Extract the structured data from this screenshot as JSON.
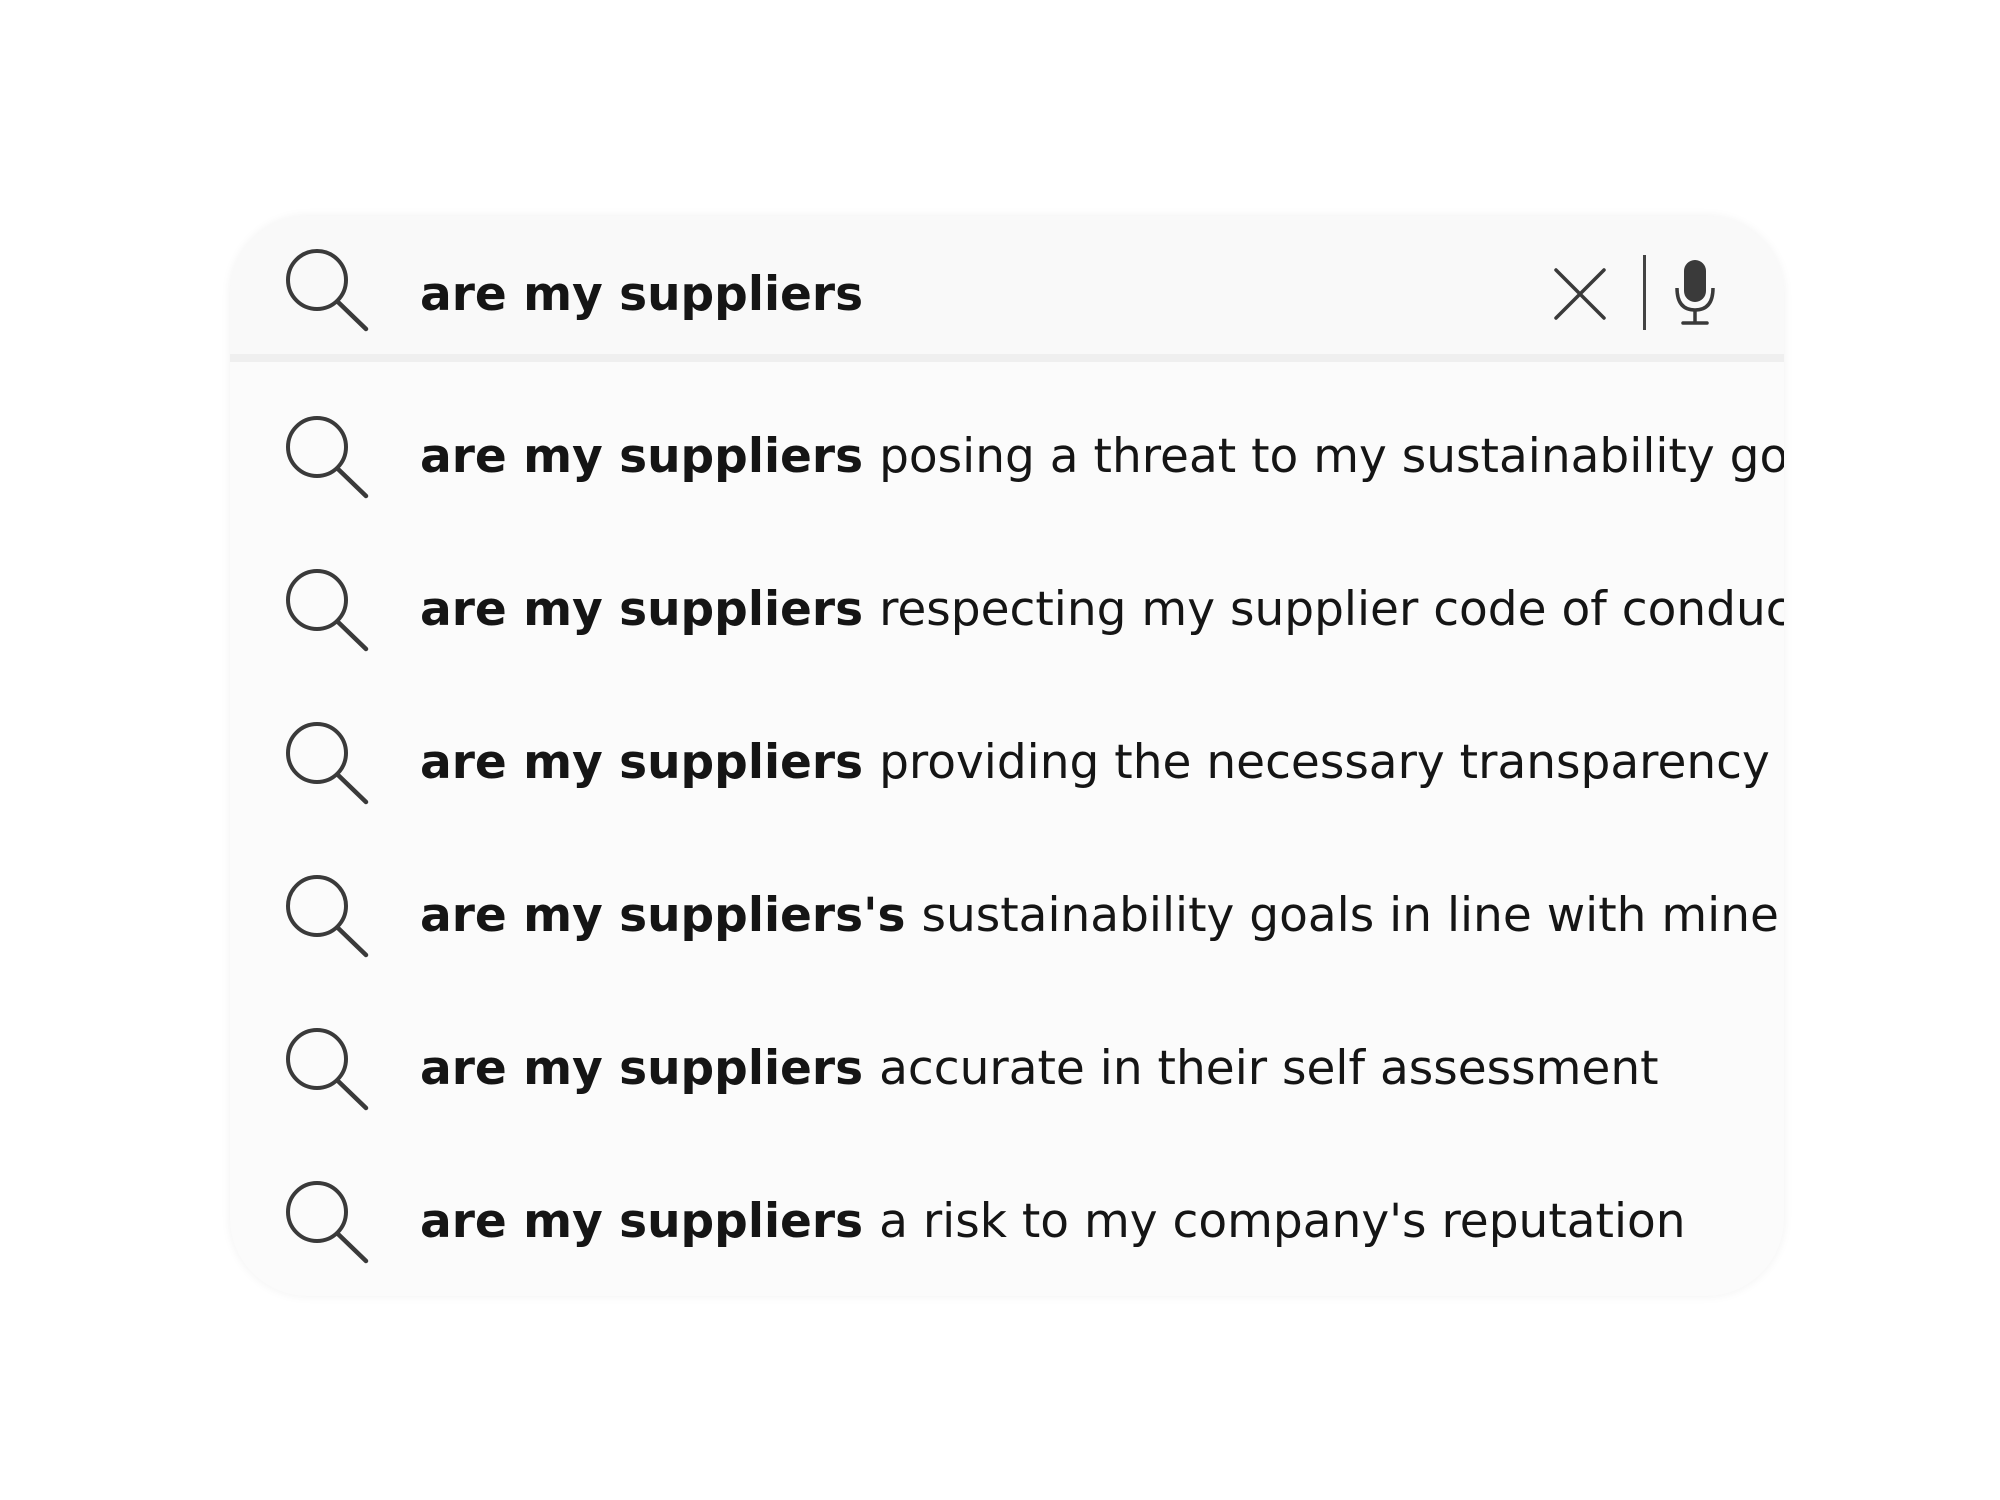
{
  "search": {
    "query": "are my suppliers",
    "clear_icon": "close-icon",
    "mic_icon": "microphone-icon",
    "search_icon": "search-icon"
  },
  "suggestions": [
    {
      "bold": "are my suppliers",
      "rest": "posing a threat to my sustainability goals"
    },
    {
      "bold": "are my suppliers",
      "rest": "respecting my supplier code of conduct"
    },
    {
      "bold": "are my suppliers",
      "rest": "providing the necessary transparency"
    },
    {
      "bold": "are my suppliers's",
      "rest": "sustainability goals in line with mine"
    },
    {
      "bold": "are my suppliers",
      "rest": "accurate in their self assessment"
    },
    {
      "bold": "are my suppliers",
      "rest": "a risk to my company's reputation"
    }
  ],
  "colors": {
    "text": "#151515",
    "icon": "#3a3a3a",
    "panel": "#fbfbfb"
  }
}
